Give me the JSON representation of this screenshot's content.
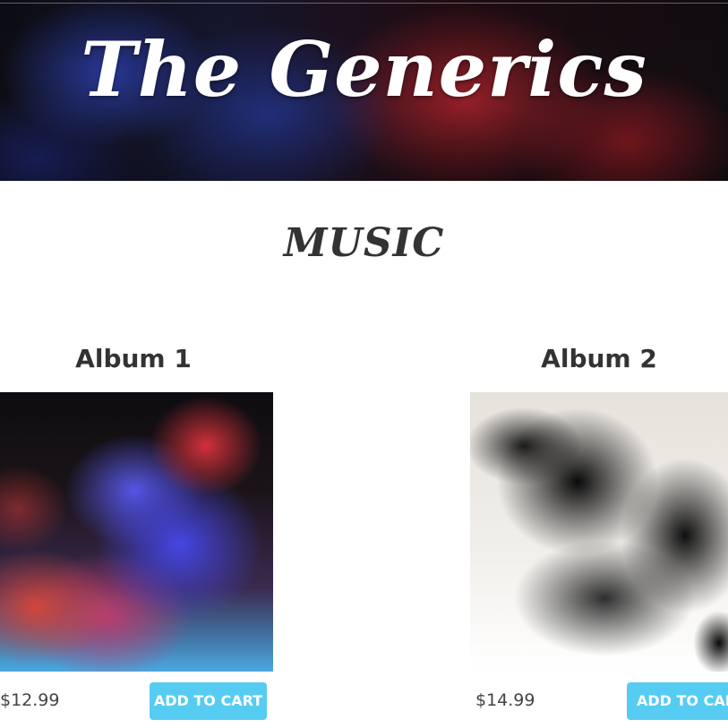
{
  "header": {
    "band_name": "The Generics"
  },
  "section": {
    "title": "MUSIC"
  },
  "albums": [
    {
      "title": "Album 1",
      "image": "album-cover-colored-smoke",
      "price": "$12.99",
      "button_label": "ADD TO CART"
    },
    {
      "title": "Album 2",
      "image": "album-cover-black-smoke",
      "price": "$14.99",
      "button_label": "ADD TO CART"
    }
  ],
  "colors": {
    "button_background": "#56ccf2",
    "button_text": "#ffffff",
    "heading_text": "#333333"
  }
}
